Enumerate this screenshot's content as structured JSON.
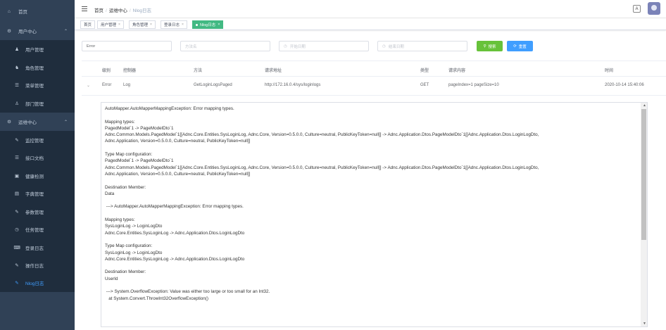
{
  "sidebar": {
    "items": [
      {
        "icon": "home-icon",
        "glyph": "⌂",
        "label": "首页"
      },
      {
        "icon": "gear-icon",
        "glyph": "⚙",
        "label": "用户中心",
        "chevron": "⌃"
      },
      {
        "icon": "user-icon",
        "glyph": "♟",
        "label": "用户管理"
      },
      {
        "icon": "role-icon",
        "glyph": "♞",
        "label": "角色管理"
      },
      {
        "icon": "menu-list-icon",
        "glyph": "☰",
        "label": "菜单管理"
      },
      {
        "icon": "department-icon",
        "glyph": "♙",
        "label": "部门管理"
      },
      {
        "icon": "operations-icon",
        "glyph": "⚙",
        "label": "运维中心",
        "chevron": "⌃"
      },
      {
        "icon": "monitor-icon",
        "glyph": "✎",
        "label": "监控管理"
      },
      {
        "icon": "document-icon",
        "glyph": "☰",
        "label": "接口文档"
      },
      {
        "icon": "health-check-icon",
        "glyph": "▣",
        "label": "健康检测"
      },
      {
        "icon": "dictionary-icon",
        "glyph": "▤",
        "label": "字典管理"
      },
      {
        "icon": "parameter-icon",
        "glyph": "✎",
        "label": "参数管理"
      },
      {
        "icon": "clock-icon",
        "glyph": "◷",
        "label": "任务管理"
      },
      {
        "icon": "login-log-icon",
        "glyph": "⌨",
        "label": "登录日志"
      },
      {
        "icon": "operation-log-icon",
        "glyph": "✎",
        "label": "操作日志"
      },
      {
        "icon": "nlog-icon",
        "glyph": "✎",
        "label": "Nlog日志"
      }
    ]
  },
  "header": {
    "breadcrumb": [
      "首页",
      "运维中心",
      "Nlog日志"
    ],
    "sep": "/",
    "lang_icon": "A",
    "lang_icon_name": "translate-icon"
  },
  "tags": [
    {
      "label": "首页",
      "close": ""
    },
    {
      "label": "用户管理",
      "close": "×"
    },
    {
      "label": "角色管理",
      "close": "×"
    },
    {
      "label": "登录日志",
      "close": "×"
    },
    {
      "label": "Nlog日志",
      "close": "×"
    }
  ],
  "filters": {
    "level_value": "Error",
    "method_placeholder": "方法名",
    "start_placeholder": "开始日期",
    "end_placeholder": "结束日期",
    "search_label": "搜索",
    "reset_label": "重置",
    "search_glyph": "⚲",
    "reset_glyph": "⟳",
    "cal_glyph": "◷"
  },
  "table": {
    "columns": [
      "级别",
      "控制器",
      "方法",
      "请求地址",
      "类型",
      "请求内容",
      "时间"
    ],
    "row": {
      "expand": "⌄",
      "level": "Error",
      "controller": "Log",
      "method": "GetLoginLogsPaged",
      "url": "http://172.16.0.4/sys/loginlogs",
      "type": "GET",
      "content": "pageIndex=1 pageSize=10",
      "time": "2020-10-14 15:40:06"
    }
  },
  "colors": {
    "sidebar_bg": "#304156",
    "sidebar_text": "#bfcbd9",
    "accent": "#409eff",
    "search_button": "#67c23a",
    "active_tag": "#42b983"
  },
  "detail": {
    "text": "AutoMapper.AutoMapperMappingException: Error mapping types.\n\nMapping types:\nPagedModel`1 -> PageModelDto`1\nAdnc.Common.Models.PagedModel`1[[Adnc.Core.Entities.SysLoginLog, Adnc.Core, Version=0.5.0.0, Culture=neutral, PublicKeyToken=null]] -> Adnc.Application.Dtos.PageModelDto`1[[Adnc.Application.Dtos.LoginLogDto,\nAdnc.Application, Version=0.5.0.0, Culture=neutral, PublicKeyToken=null]]\n\nType Map configuration:\nPagedModel`1 -> PageModelDto`1\nAdnc.Common.Models.PagedModel`1[[Adnc.Core.Entities.SysLoginLog, Adnc.Core, Version=0.5.0.0, Culture=neutral, PublicKeyToken=null]] -> Adnc.Application.Dtos.PageModelDto`1[[Adnc.Application.Dtos.LoginLogDto,\nAdnc.Application, Version=0.5.0.0, Culture=neutral, PublicKeyToken=null]]\n\nDestination Member:\nData\n\n ---> AutoMapper.AutoMapperMappingException: Error mapping types.\n\nMapping types:\nSysLoginLog -> LoginLogDto\nAdnc.Core.Entities.SysLoginLog -> Adnc.Application.Dtos.LoginLogDto\n\nType Map configuration:\nSysLoginLog -> LoginLogDto\nAdnc.Core.Entities.SysLoginLog -> Adnc.Application.Dtos.LoginLogDto\n\nDestination Member:\nUserId\n\n ---> System.OverflowException: Value was either too large or too small for an Int32.\n   at System.Convert.ThrowInt32OverflowException()",
    "scroll_up": "▲",
    "scroll_down": "▼"
  }
}
